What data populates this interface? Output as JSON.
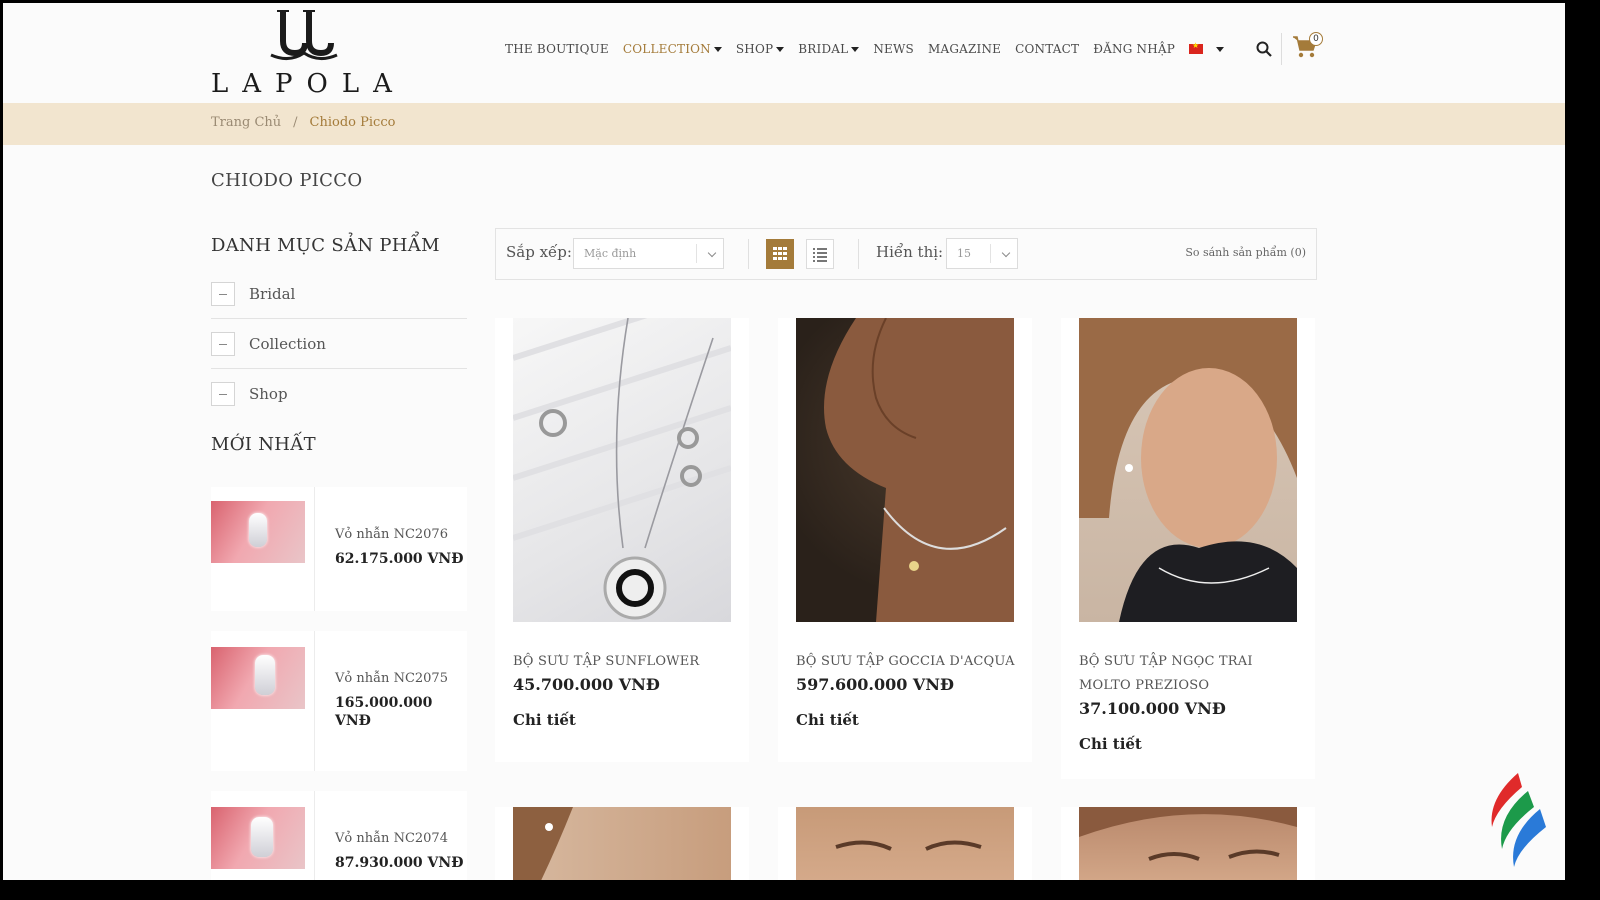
{
  "brand": {
    "name": "LAPOLA"
  },
  "nav": {
    "items": [
      {
        "label": "THE BOUTIQUE",
        "dropdown": false,
        "active": false
      },
      {
        "label": "COLLECTION",
        "dropdown": true,
        "active": true
      },
      {
        "label": "SHOP",
        "dropdown": true,
        "active": false
      },
      {
        "label": "BRIDAL",
        "dropdown": true,
        "active": false
      },
      {
        "label": "NEWS",
        "dropdown": false,
        "active": false
      },
      {
        "label": "MAGAZINE",
        "dropdown": false,
        "active": false
      },
      {
        "label": "CONTACT",
        "dropdown": false,
        "active": false
      },
      {
        "label": "ĐĂNG NHẬP",
        "dropdown": false,
        "active": false
      }
    ],
    "language_icon": "vietnam-flag-icon",
    "cart_count": "0"
  },
  "breadcrumb": {
    "home": "Trang Chủ",
    "separator": "/",
    "current": "Chiodo Picco"
  },
  "page": {
    "title": "CHIODO PICCO"
  },
  "sidebar": {
    "categories_heading": "DANH MỤC SẢN PHẨM",
    "categories": [
      "Bridal",
      "Collection",
      "Shop"
    ],
    "latest_heading": "MỚI NHẤT",
    "latest": [
      {
        "name": "Vỏ nhẫn NC2076",
        "price": "62.175.000 VNĐ"
      },
      {
        "name": "Vỏ nhẫn NC2075",
        "price": "165.000.000 VNĐ"
      },
      {
        "name": "Vỏ nhẫn NC2074",
        "price": "87.930.000 VNĐ"
      }
    ]
  },
  "toolbar": {
    "sort_label": "Sắp xếp:",
    "sort_value": "Mặc định",
    "view_grid_icon": "grid-view-icon",
    "view_list_icon": "list-view-icon",
    "show_label": "Hiển thị:",
    "show_value": "15",
    "compare": "So sánh sản phẩm (0)"
  },
  "products": [
    {
      "name": "BỘ SƯU TẬP SUNFLOWER",
      "price": "45.700.000 VNĐ",
      "link": "Chi tiết"
    },
    {
      "name": "BỘ SƯU TẬP GOCCIA D'ACQUA",
      "price": "597.600.000 VNĐ",
      "link": "Chi tiết"
    },
    {
      "name": "BỘ SƯU TẬP NGỌC TRAI MOLTO PREZIOSO",
      "price": "37.100.000 VNĐ",
      "link": "Chi tiết"
    }
  ],
  "colors": {
    "accent": "#a47b3a",
    "breadcrumb_bg": "#f2e5cf"
  }
}
